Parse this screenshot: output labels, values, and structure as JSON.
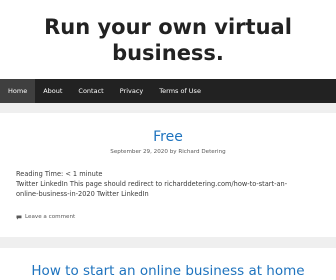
{
  "site": {
    "title": "Run your own virtual business."
  },
  "nav": {
    "items": [
      {
        "label": "Home"
      },
      {
        "label": "About"
      },
      {
        "label": "Contact"
      },
      {
        "label": "Privacy"
      },
      {
        "label": "Terms of Use"
      }
    ]
  },
  "post": {
    "title": "Free",
    "date": "September 29, 2020",
    "by": "by",
    "author": "Richard Detering",
    "reading_time": "Reading Time: < 1 minute",
    "content_line1": "Twitter LinkedIn This page should redirect to richarddetering.com/how-to-start-an-",
    "content_line2": "online-business-in-2020 Twitter LinkedIn",
    "comment_link": "Leave a comment",
    "comment_icon": "comment-icon"
  },
  "post2": {
    "title": "How to start an online business at home"
  },
  "colors": {
    "nav_bg": "#222222",
    "nav_active_bg": "#3f3f3f",
    "link": "#1e73be",
    "page_bg": "#efefef"
  }
}
